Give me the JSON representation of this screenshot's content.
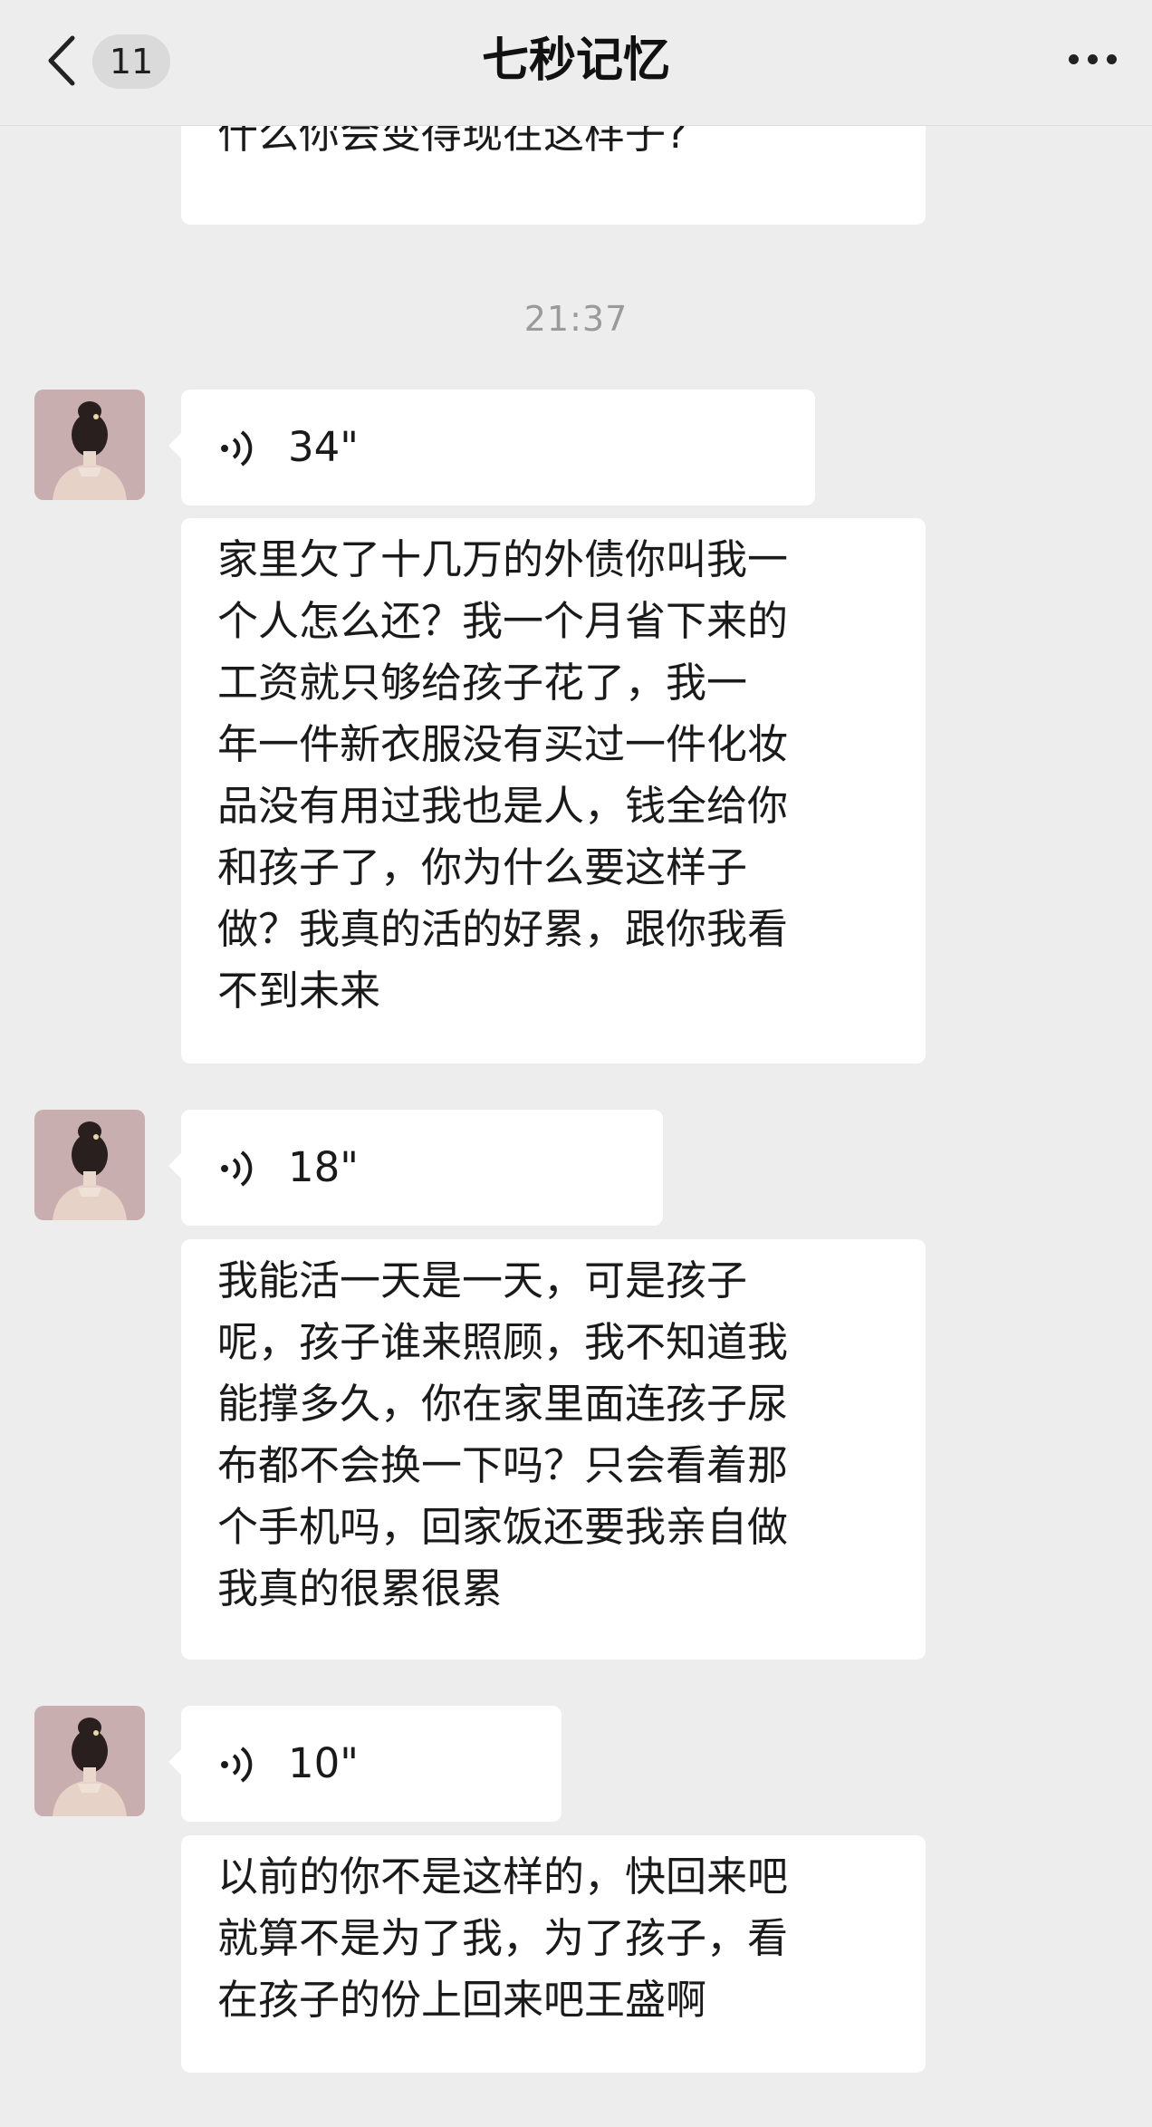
{
  "header": {
    "title": "七秒记忆",
    "unread_count": "11",
    "back_icon": "chevron-left-icon",
    "more_icon": "more-dots-icon"
  },
  "messages": [
    {
      "type": "text",
      "lines": [
        "什么你会变得现在这样子?"
      ]
    },
    {
      "type": "time",
      "text": "21:37"
    },
    {
      "type": "voice",
      "duration": "34\""
    },
    {
      "type": "text",
      "lines": [
        "家里欠了十几万的外债你叫我一",
        "个人怎么还？我一个月省下来的",
        "工资就只够给孩子花了，我一",
        "年一件新衣服没有买过一件化妆",
        "品没有用过我也是人，钱全给你",
        "和孩子了，你为什么要这样子",
        "做？我真的活的好累，跟你我看",
        "不到未来"
      ]
    },
    {
      "type": "voice",
      "duration": "18\""
    },
    {
      "type": "text",
      "lines": [
        "我能活一天是一天，可是孩子",
        "呢，孩子谁来照顾，我不知道我",
        "能撑多久，你在家里面连孩子尿",
        "布都不会换一下吗？只会看着那",
        "个手机吗，回家饭还要我亲自做",
        "我真的很累很累"
      ]
    },
    {
      "type": "voice",
      "duration": "10\""
    },
    {
      "type": "text",
      "lines": [
        "以前的你不是这样的，快回来吧",
        "就算不是为了我，为了孩子，看",
        "在孩子的份上回来吧王盛啊"
      ]
    }
  ],
  "colors": {
    "background": "#ededed",
    "bubble": "#ffffff",
    "timestamp": "#9a9a9a"
  }
}
